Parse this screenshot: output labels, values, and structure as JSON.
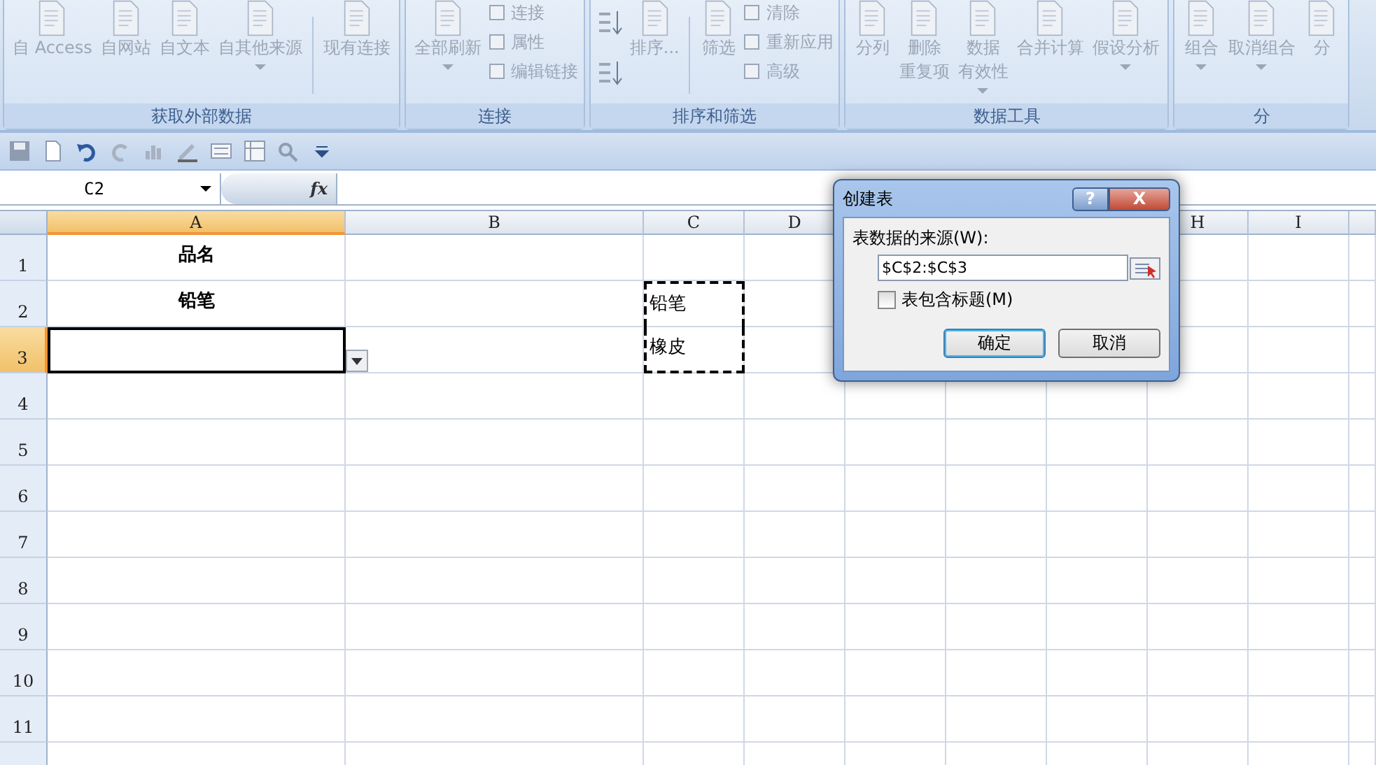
{
  "ribbon": {
    "groups": [
      {
        "label": "获取外部数据",
        "items": [
          {
            "kind": "large",
            "label": "自 Access",
            "dropdown": false
          },
          {
            "kind": "large",
            "label": "自网站",
            "dropdown": false
          },
          {
            "kind": "large",
            "label": "自文本",
            "dropdown": false
          },
          {
            "kind": "large",
            "label": "自其他来源",
            "dropdown": true
          },
          {
            "kind": "separator"
          },
          {
            "kind": "large",
            "label": "现有连接",
            "dropdown": false
          }
        ]
      },
      {
        "label": "连接",
        "items": [
          {
            "kind": "large",
            "label": "全部刷新",
            "dropdown": true
          },
          {
            "kind": "stack",
            "children": [
              {
                "label": "连接"
              },
              {
                "label": "属性"
              },
              {
                "label": "编辑链接"
              }
            ]
          }
        ]
      },
      {
        "label": "排序和筛选",
        "items": [
          {
            "kind": "sort"
          },
          {
            "kind": "large",
            "label": "排序...",
            "dropdown": false
          },
          {
            "kind": "separator"
          },
          {
            "kind": "large",
            "label": "筛选",
            "dropdown": false
          },
          {
            "kind": "stack",
            "children": [
              {
                "label": "清除"
              },
              {
                "label": "重新应用"
              },
              {
                "label": "高级"
              }
            ]
          }
        ]
      },
      {
        "label": "数据工具",
        "items": [
          {
            "kind": "large",
            "label": "分列",
            "dropdown": false
          },
          {
            "kind": "large",
            "lines": [
              "删除",
              "重复项"
            ],
            "dropdown": false
          },
          {
            "kind": "large",
            "lines": [
              "数据",
              "有效性"
            ],
            "dropdown": true
          },
          {
            "kind": "large",
            "label": "合并计算",
            "dropdown": false
          },
          {
            "kind": "large",
            "label": "假设分析",
            "dropdown": true
          }
        ]
      },
      {
        "label": "分",
        "items": [
          {
            "kind": "large",
            "label": "组合",
            "dropdown": true
          },
          {
            "kind": "large",
            "label": "取消组合",
            "dropdown": true
          },
          {
            "kind": "large",
            "label": "分",
            "dropdown": false
          }
        ]
      }
    ]
  },
  "name_box": "C2",
  "fx": "fx",
  "sheet": {
    "columns": [
      {
        "label": "A",
        "selected": true
      },
      {
        "label": "B",
        "selected": false
      },
      {
        "label": "C",
        "selected": false
      },
      {
        "label": "D",
        "selected": false
      },
      {},
      {},
      {},
      {
        "label": "H",
        "selected": false
      },
      {
        "label": "I",
        "selected": false
      },
      {}
    ],
    "rows": [
      {
        "label": "1",
        "selected": false,
        "cells": [
          {
            "text": "品名",
            "bold": true
          }
        ]
      },
      {
        "label": "2",
        "selected": false,
        "cells": [
          {
            "text": "铅笔",
            "bold": true
          },
          {},
          {
            "text": "铅笔",
            "bold": false,
            "marquee": true
          }
        ]
      },
      {
        "label": "3",
        "selected": true,
        "cells": [
          {
            "active": true,
            "dropdown": true
          },
          {},
          {
            "text": "橡皮",
            "bold": false,
            "marquee": true
          }
        ]
      },
      {
        "label": "4",
        "selected": false
      },
      {
        "label": "5",
        "selected": false
      },
      {
        "label": "6",
        "selected": false
      },
      {
        "label": "7",
        "selected": false
      },
      {
        "label": "8",
        "selected": false
      },
      {
        "label": "9",
        "selected": false
      },
      {
        "label": "10",
        "selected": false
      },
      {
        "label": "11",
        "selected": false
      }
    ]
  },
  "dialog": {
    "title": "创建表",
    "help": "?",
    "close": "X",
    "source_label": "表数据的来源(W):",
    "source_value": "$C$2:$C$3",
    "header_checkbox": {
      "label": "表包含标题(M)",
      "checked": false
    },
    "buttons": [
      {
        "label": "确定",
        "default": true
      },
      {
        "label": "取消",
        "default": false
      }
    ]
  }
}
